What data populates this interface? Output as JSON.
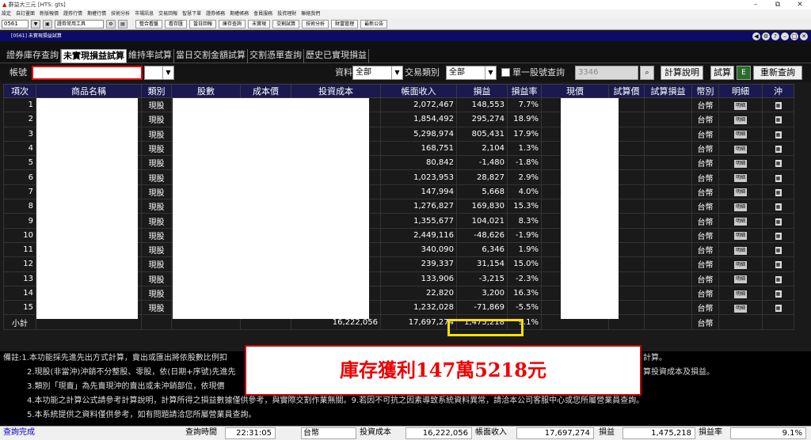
{
  "title": "群益大三元 [HTS: gts]",
  "win_buttons": {
    "minimize": "–",
    "restore": "⧉",
    "close": "✕"
  },
  "menu": [
    "設定",
    "自訂畫面",
    "新版報價",
    "證券行情",
    "期權行情",
    "技術分析",
    "市場訊息",
    "交易回報",
    "智慧下單",
    "證券帳務",
    "期權帳務",
    "會員服務",
    "投資理財",
    "聯絡我們"
  ],
  "toolbar": {
    "code": "0561",
    "tool_select": "證券常用工具",
    "buttons": [
      "整合看盤",
      "看存匯",
      "當日回報",
      "庫存查詢",
      "未實現",
      "交割試算",
      "技術分析",
      "財富管理",
      "最新公告"
    ]
  },
  "panel_title": "[0561] 未實現損益試算",
  "tabs": [
    "證券庫存查詢",
    "未實現損益試算",
    "維持率試算",
    "當日交割金額試算",
    "交割憑單查詢",
    "歷史已實現損益"
  ],
  "filter": {
    "account_label": "帳號",
    "data_label": "資料",
    "data_value": "全部",
    "trade_label": "交易類別",
    "trade_value": "全部",
    "single_label": "單一股號查詢",
    "single_value": "3346",
    "calc_desc": "計算說明",
    "trial": "試算",
    "requery": "重新查詢"
  },
  "columns": [
    "項次",
    "商品名稱",
    "類別",
    "股數",
    "成本價",
    "投資成本",
    "帳面收入",
    "損益",
    "損益率",
    "現價",
    "試算價",
    "試算損益",
    "幣別",
    "明細",
    "沖"
  ],
  "rows": [
    {
      "no": "1",
      "type": "現股",
      "income": "2,072,467",
      "pl": "148,553",
      "rate": "7.7%",
      "pos": true,
      "cur": "台幣",
      "detail": "明細"
    },
    {
      "no": "2",
      "type": "現股",
      "income": "1,854,492",
      "pl": "295,274",
      "rate": "18.9%",
      "pos": true,
      "cur": "台幣",
      "detail": "明細"
    },
    {
      "no": "3",
      "type": "現股",
      "income": "5,298,974",
      "pl": "805,431",
      "rate": "17.9%",
      "pos": true,
      "cur": "台幣",
      "detail": "明細"
    },
    {
      "no": "4",
      "type": "現股",
      "income": "168,751",
      "pl": "2,104",
      "rate": "1.3%",
      "pos": true,
      "cur": "台幣",
      "detail": "明細"
    },
    {
      "no": "5",
      "type": "現股",
      "income": "80,842",
      "pl": "-1,480",
      "rate": "-1.8%",
      "pos": false,
      "cur": "台幣",
      "detail": "明細"
    },
    {
      "no": "6",
      "type": "現股",
      "income": "1,023,953",
      "pl": "28,827",
      "rate": "2.9%",
      "pos": true,
      "cur": "台幣",
      "detail": "明細"
    },
    {
      "no": "7",
      "type": "現股",
      "income": "147,994",
      "pl": "5,668",
      "rate": "4.0%",
      "pos": true,
      "cur": "台幣",
      "detail": "明細"
    },
    {
      "no": "8",
      "type": "現股",
      "income": "1,276,827",
      "pl": "169,830",
      "rate": "15.3%",
      "pos": true,
      "cur": "台幣",
      "detail": "明細"
    },
    {
      "no": "9",
      "type": "現股",
      "income": "1,355,677",
      "pl": "104,021",
      "rate": "8.3%",
      "pos": true,
      "cur": "台幣",
      "detail": "明細"
    },
    {
      "no": "10",
      "type": "現股",
      "income": "2,449,116",
      "pl": "-48,626",
      "rate": "-1.9%",
      "pos": false,
      "cur": "台幣",
      "detail": "明細"
    },
    {
      "no": "11",
      "type": "現股",
      "income": "340,090",
      "pl": "6,346",
      "rate": "1.9%",
      "pos": true,
      "cur": "台幣",
      "detail": "明細"
    },
    {
      "no": "12",
      "type": "現股",
      "income": "239,337",
      "pl": "31,154",
      "rate": "15.0%",
      "pos": true,
      "cur": "台幣",
      "detail": "明細"
    },
    {
      "no": "13",
      "type": "現股",
      "income": "133,906",
      "pl": "-3,215",
      "rate": "-2.3%",
      "pos": false,
      "cur": "台幣",
      "detail": "明細"
    },
    {
      "no": "14",
      "type": "現股",
      "income": "22,820",
      "pl": "3,200",
      "rate": "16.3%",
      "pos": true,
      "cur": "台幣",
      "detail": "明細"
    },
    {
      "no": "15",
      "type": "現股",
      "income": "1,232,028",
      "pl": "-71,869",
      "rate": "-5.5%",
      "pos": false,
      "cur": "台幣",
      "detail": "明細"
    }
  ],
  "subtotal": {
    "label": "小計",
    "cost": "16,222,056",
    "income": "17,697,274",
    "pl": "1,475,218",
    "rate": "9.1%",
    "cur": "台幣"
  },
  "notes": [
    "備註:1.本功能採先進先出方式計算，賣出或匯出將依股數比例扣",
    "計算。",
    "2.現股(非當沖)沖銷不分整股、零股，依(日期+序號)先進先",
    "算投資成本及損益。",
    "3.類別「現賣」為先賣現沖的賣出或未沖銷部位，依現價",
    "4.本功能之計算公式請參考計算說明，計算所得之損益數據僅供參考，與實際交割作業無關。9.若因不可抗之因素導致系統資料異常，請洽本公司客服中心或您所屬營業員查詢。",
    "5.本系統提供之資料僅供參考，如有問題請洽您所屬營業員查詢。"
  ],
  "banner": "庫存獲利147萬5218元",
  "status": {
    "state": "查詢完成",
    "time_label": "查詢時間",
    "time": "22:31:05",
    "currency": "台幣",
    "cost_label": "投資成本",
    "cost": "16,222,056",
    "income_label": "帳面收入",
    "income": "17,697,274",
    "pl_label": "損益",
    "pl": "1,475,218",
    "rate_label": "損益率",
    "rate": "9.1%"
  }
}
